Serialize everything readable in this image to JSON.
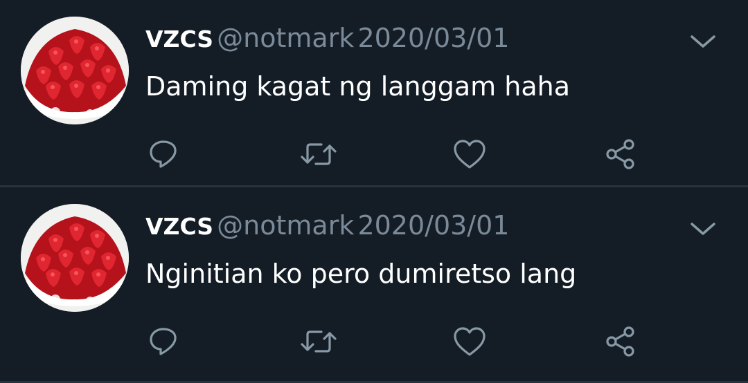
{
  "tweets": [
    {
      "name": "VZCS",
      "handle": "@notmark",
      "date": "2020/03/01",
      "text": "Daming kagat ng langgam haha",
      "avatar": "strawberry-cake-avatar"
    },
    {
      "name": "VZCS",
      "handle": "@notmark",
      "date": "2020/03/01",
      "text": "Nginitian ko pero dumiretso lang",
      "avatar": "strawberry-cake-avatar"
    }
  ],
  "icons": {
    "reply": "reply-icon",
    "retweet": "retweet-icon",
    "like": "heart-icon",
    "share": "share-icon",
    "menu": "chevron-down-icon"
  },
  "colors": {
    "background": "#141d26",
    "divider": "#26333f",
    "secondary_text": "#7b8a98",
    "icon": "#8899a6"
  }
}
